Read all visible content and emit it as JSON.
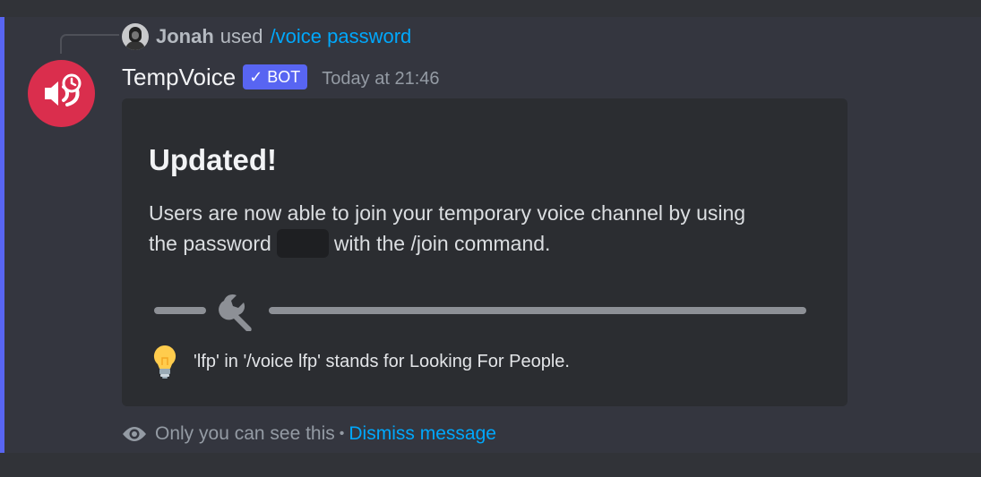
{
  "reply": {
    "username": "Jonah",
    "action": "used",
    "command": "/voice password"
  },
  "message": {
    "author": "TempVoice",
    "bot_tag": "BOT",
    "timestamp": "Today at 21:46"
  },
  "embed": {
    "title": "Updated!",
    "description_line1": "Users are now able to join your temporary voice channel by using",
    "description_line2_before": "the password",
    "description_line2_after": "with the /join command.",
    "tip_text": "'lfp' in '/voice lfp' stands for Looking For People."
  },
  "footer": {
    "only_you_text": "Only you can see this",
    "separator": "•",
    "dismiss_label": "Dismiss message"
  },
  "colors": {
    "accent_bar": "#5865f2",
    "bot_avatar": "#da2e4d",
    "link": "#00a8fc"
  },
  "icons": [
    "user-avatar-icon",
    "speaker-clock-icon",
    "check-icon",
    "wrench-icon",
    "lightbulb-icon",
    "eye-icon"
  ]
}
